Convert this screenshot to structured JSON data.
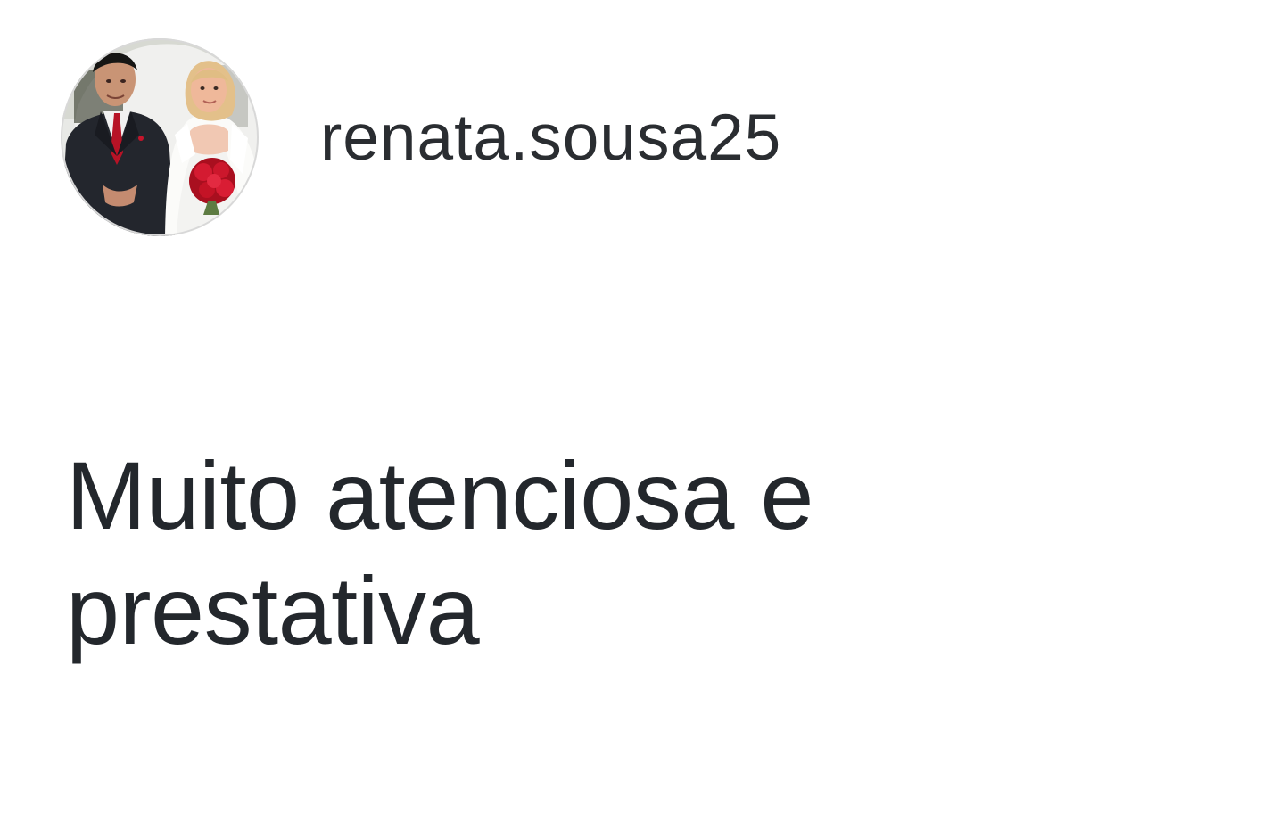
{
  "comment": {
    "author": {
      "username": "renata.sousa25",
      "avatar_icon": "wedding-couple-photo"
    },
    "text": "Muito atenciosa e prestativa"
  },
  "colors": {
    "background": "#ffffff",
    "text": "#23272c",
    "bouquet": "#c4152a"
  }
}
